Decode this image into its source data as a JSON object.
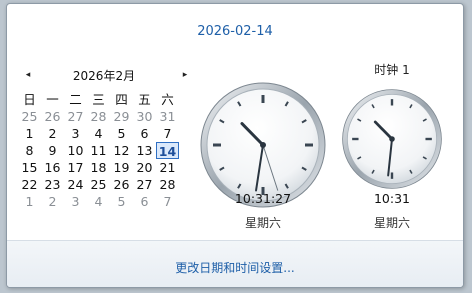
{
  "header": {
    "date": "2026-02-14"
  },
  "calendar": {
    "month_label": "2026年2月",
    "prev_glyph": "◂",
    "next_glyph": "▸",
    "weekdays": [
      "日",
      "一",
      "二",
      "三",
      "四",
      "五",
      "六"
    ],
    "weeks": [
      [
        "25",
        "26",
        "27",
        "28",
        "29",
        "30",
        "31"
      ],
      [
        "1",
        "2",
        "3",
        "4",
        "5",
        "6",
        "7"
      ],
      [
        "8",
        "9",
        "10",
        "11",
        "12",
        "13",
        "14"
      ],
      [
        "15",
        "16",
        "17",
        "18",
        "19",
        "20",
        "21"
      ],
      [
        "22",
        "23",
        "24",
        "25",
        "26",
        "27",
        "28"
      ],
      [
        "1",
        "2",
        "3",
        "4",
        "5",
        "6",
        "7"
      ]
    ],
    "selected_day": "14"
  },
  "clocks": {
    "main": {
      "time": "10:31:27",
      "weekday": "星期六",
      "hour": 10,
      "minute": 31,
      "second": 27
    },
    "second": {
      "title": "时钟 1",
      "time": "10:31",
      "weekday": "星期六",
      "hour": 10,
      "minute": 31
    }
  },
  "footer": {
    "link_label": "更改日期和时间设置..."
  },
  "colors": {
    "accent": "#1e5fa8",
    "other_month": "#8a8f95",
    "today_border": "#2f6fc3"
  }
}
